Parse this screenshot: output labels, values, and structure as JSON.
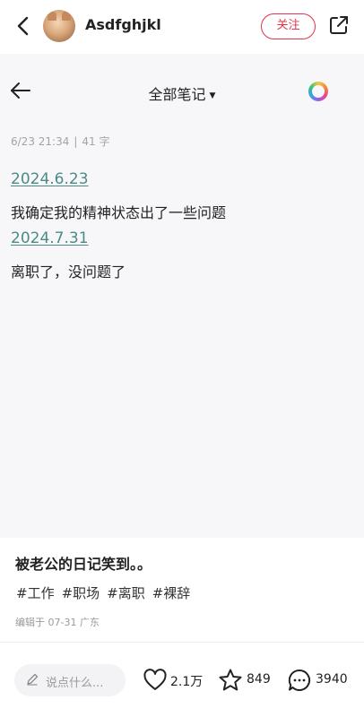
{
  "header": {
    "username": "Asdfghjkl",
    "follow_label": "关注"
  },
  "viewer": {
    "title": "全部笔记",
    "meta_datetime": "6/23 21:34",
    "meta_separator": "|",
    "meta_wordcount": "41 字",
    "entries": [
      {
        "date": "2024.6.23",
        "text": "我确定我的精神状态出了一些问题"
      },
      {
        "date": "2024.7.31",
        "text": "离职了，没问题了"
      }
    ]
  },
  "post": {
    "caption": "被老公的日记笑到。。",
    "tags": [
      "#工作",
      "#职场",
      "#离职",
      "#裸辞"
    ],
    "edited": "编辑于 07-31 广东"
  },
  "actions": {
    "comment_placeholder": "说点什么...",
    "likes": "2.1万",
    "favorites": "849",
    "comments": "3940"
  },
  "colors": {
    "accent_red": "#e8334a",
    "date_link": "#4a8c85",
    "viewer_bg": "#f7f7f9"
  }
}
